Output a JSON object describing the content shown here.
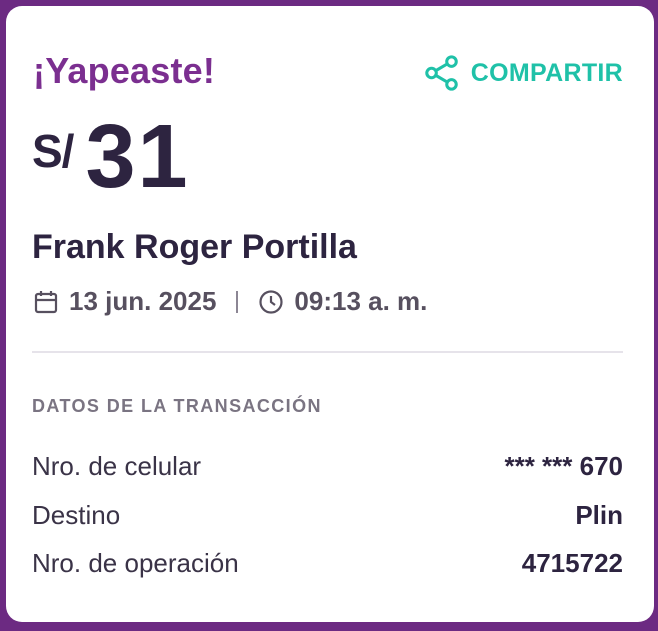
{
  "headline": "¡Yapeaste!",
  "share": {
    "label": "COMPARTIR",
    "icon": "share-icon"
  },
  "amount": {
    "currency": "S/",
    "value": "31"
  },
  "recipient": "Frank Roger Portilla",
  "date": {
    "icon": "calendar-icon",
    "text": "13 jun. 2025"
  },
  "time": {
    "icon": "clock-icon",
    "text": "09:13 a. m."
  },
  "section_title": "DATOS DE LA TRANSACCIÓN",
  "rows": [
    {
      "label": "Nro. de celular",
      "value": "*** *** 670"
    },
    {
      "label": "Destino",
      "value": "Plin"
    },
    {
      "label": "Nro. de operación",
      "value": "4715722"
    }
  ],
  "colors": {
    "brand_purple": "#7b2f90",
    "accent_teal": "#1fc1a8",
    "text_dark": "#2d2440",
    "background": "#6c2a82"
  }
}
